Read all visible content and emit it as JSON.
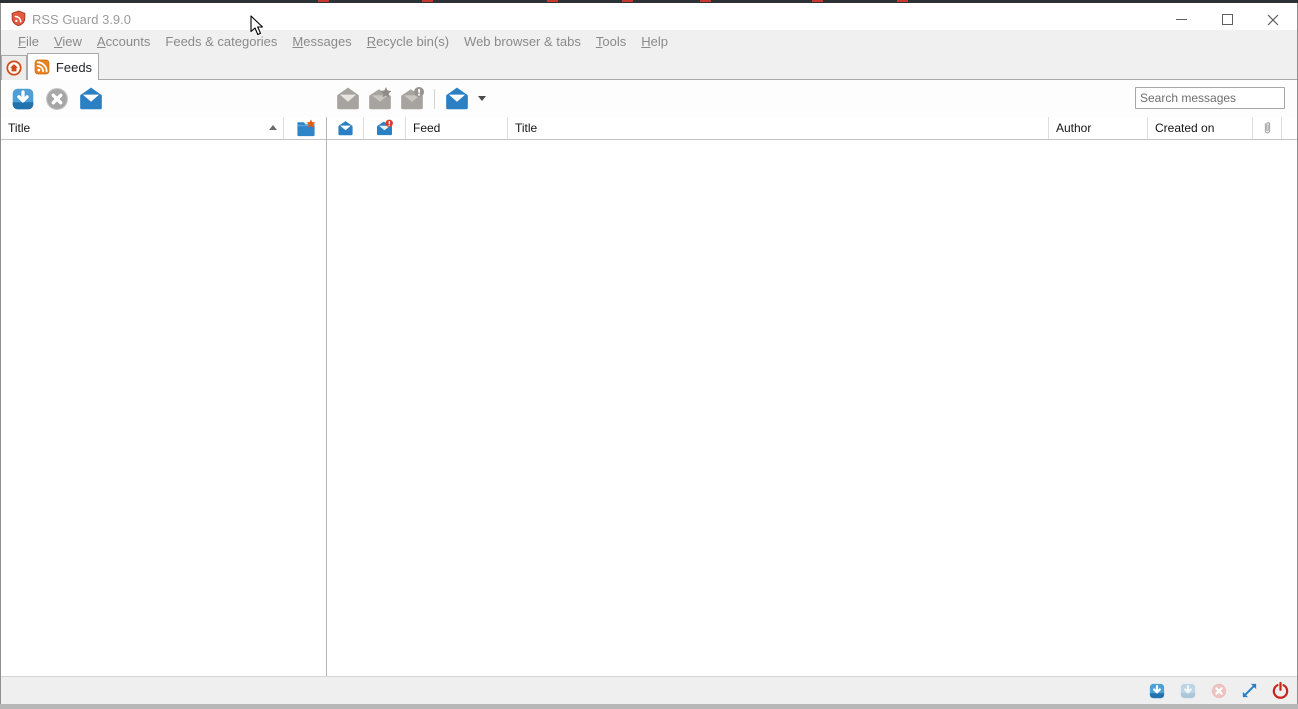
{
  "window": {
    "title": "RSS Guard 3.9.0",
    "app_icon": "rss-guard-shield-icon",
    "controls": [
      {
        "name": "minimize"
      },
      {
        "name": "maximize"
      },
      {
        "name": "close"
      }
    ]
  },
  "menubar": {
    "items": [
      {
        "label": "File",
        "mnemonic": "F"
      },
      {
        "label": "View",
        "mnemonic": "V"
      },
      {
        "label": "Accounts",
        "mnemonic": "A"
      },
      {
        "label": "Feeds & categories",
        "mnemonic": ""
      },
      {
        "label": "Messages",
        "mnemonic": "M"
      },
      {
        "label": "Recycle bin(s)",
        "mnemonic": "R"
      },
      {
        "label": "Web browser & tabs",
        "mnemonic": ""
      },
      {
        "label": "Tools",
        "mnemonic": "T"
      },
      {
        "label": "Help",
        "mnemonic": "H"
      }
    ]
  },
  "tabbar": {
    "tabs": [
      {
        "id": "home",
        "icon": "home-icon",
        "label": "",
        "active": false
      },
      {
        "id": "feeds",
        "icon": "rss-icon",
        "label": "Feeds",
        "active": true
      }
    ]
  },
  "feeds_toolbar": {
    "buttons": [
      {
        "icon": "update-feeds-icon",
        "enabled": true
      },
      {
        "icon": "stop-update-icon",
        "enabled": false
      },
      {
        "icon": "mark-all-read-icon",
        "enabled": true
      }
    ]
  },
  "messages_toolbar": {
    "buttons": [
      {
        "icon": "mark-read-envelope-icon",
        "enabled": false
      },
      {
        "icon": "mark-important-envelope-star-icon",
        "enabled": false
      },
      {
        "icon": "mark-unread-envelope-alert-icon",
        "enabled": false
      },
      {
        "icon": "mark-read-dropdown-envelope-icon",
        "enabled": true
      }
    ]
  },
  "search": {
    "placeholder": "Search messages",
    "value": ""
  },
  "feed_list": {
    "columns": [
      {
        "label": "Title",
        "sorted": "asc"
      },
      {
        "label": "",
        "icon": "counts-folder-star-icon"
      }
    ],
    "rows": []
  },
  "message_list": {
    "columns": [
      {
        "label": "",
        "icon": "read-status-envelope-icon"
      },
      {
        "label": "",
        "icon": "importance-envelope-alert-icon"
      },
      {
        "label": "Feed"
      },
      {
        "label": "Title"
      },
      {
        "label": "Author"
      },
      {
        "label": "Created on"
      },
      {
        "label": "",
        "icon": "attachment-paperclip-icon"
      }
    ],
    "rows": []
  },
  "statusbar": {
    "buttons": [
      {
        "icon": "update-feeds-icon",
        "enabled": true
      },
      {
        "icon": "update-selected-feeds-icon",
        "enabled": false
      },
      {
        "icon": "stop-update-icon",
        "enabled": false
      },
      {
        "icon": "fullscreen-expand-icon",
        "enabled": true
      },
      {
        "icon": "quit-power-icon",
        "enabled": true
      }
    ]
  },
  "colors": {
    "accent_blue": "#2b80c4",
    "accent_orange": "#e8711c",
    "brand_red": "#dd4b39",
    "quit_red": "#c8241e",
    "chrome_bg": "#f0f0f0",
    "statusbar_bg": "#efefef",
    "header_border": "#c4c4c4"
  }
}
